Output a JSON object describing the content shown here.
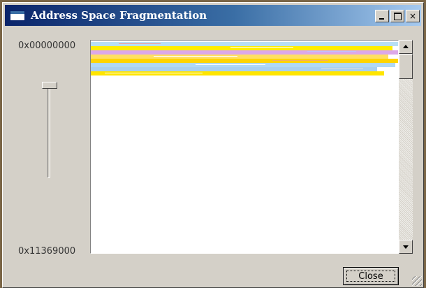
{
  "window": {
    "title": "Address Space Fragmentation",
    "minimize_label": "_",
    "close_caption": "×"
  },
  "addresses": {
    "top": "0x00000000",
    "bottom": "0x11369000"
  },
  "slider": {
    "position": 0.0
  },
  "map": {
    "stripes": [
      {
        "color": "#b8dff5"
      },
      {
        "color": "#ffee00"
      },
      {
        "color": "#dca8e8"
      },
      {
        "color": "#ffe060"
      },
      {
        "color": "#ffd400"
      },
      {
        "color": "#b0d8f6"
      },
      {
        "color": "#a8d0f0"
      },
      {
        "color": "#ffe500"
      }
    ]
  },
  "buttons": {
    "close": "Close"
  },
  "colors": {
    "title_start": "#0a246a",
    "title_end": "#a6caf0",
    "window_face": "#d4d0c8"
  }
}
